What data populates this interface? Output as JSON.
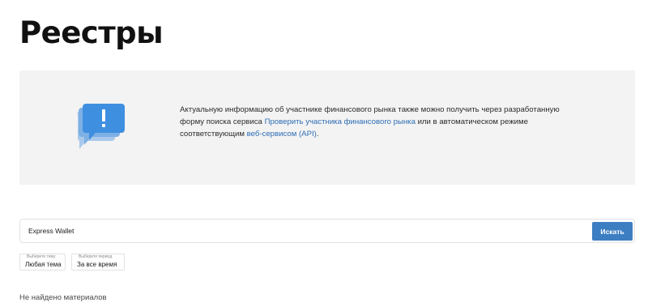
{
  "page": {
    "title": "Реестры"
  },
  "notice": {
    "icon": "exclamation-speech-bubble-icon",
    "text_before": "Актуальную информацию об участнике финансового рынка также можно получить через разработанную форму поиска сервиса ",
    "link1": "Проверить участника финансового рынка",
    "text_middle": " или в автоматическом режиме соответствующим ",
    "link2": "веб-сервисом (API)",
    "text_after": "."
  },
  "search": {
    "value": "Express Wallet",
    "button_label": "Искать"
  },
  "filters": {
    "theme": {
      "caption": "Выберите тему",
      "value": "Любая тема"
    },
    "period": {
      "caption": "Выберите период",
      "value": "За все время"
    }
  },
  "results": {
    "empty_message": "Не найдено материалов"
  },
  "colors": {
    "accent": "#3d7ec2",
    "link": "#2d6db5",
    "notice_bg": "#f3f3f3"
  }
}
